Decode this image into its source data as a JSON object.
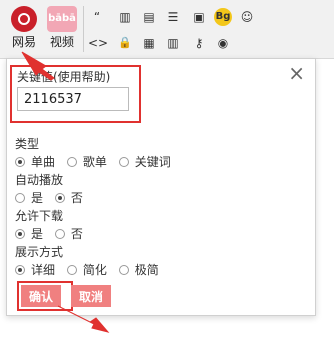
{
  "toolbar": {
    "main": [
      {
        "label": "网易",
        "icon": "netease-music-icon"
      },
      {
        "label": "视频",
        "icon": "video-icon",
        "badge": "bābā"
      }
    ],
    "tools": [
      {
        "icon": "quote-icon",
        "glyph": "“"
      },
      {
        "icon": "building-icon",
        "glyph": "▥"
      },
      {
        "icon": "document-icon",
        "glyph": "▤"
      },
      {
        "icon": "list-icon",
        "glyph": "☰"
      },
      {
        "icon": "folder-icon",
        "glyph": "▣"
      },
      {
        "icon": "bg-icon",
        "glyph": "Bg"
      },
      {
        "icon": "qq-icon",
        "glyph": "☺"
      },
      {
        "icon": "code-icon",
        "glyph": "<>"
      },
      {
        "icon": "lock-icon",
        "glyph": "🔒"
      },
      {
        "icon": "picture-icon",
        "glyph": "▦"
      },
      {
        "icon": "grid-icon",
        "glyph": "▥"
      },
      {
        "icon": "key-icon",
        "glyph": "⚷"
      },
      {
        "icon": "record-icon",
        "glyph": "◉"
      }
    ]
  },
  "dialog": {
    "close_label": "×",
    "keyword_label": "关键值(使用帮助)",
    "keyword_value": "2116537",
    "groups": [
      {
        "title": "类型",
        "options": [
          "单曲",
          "歌单",
          "关键词"
        ],
        "selected": 0
      },
      {
        "title": "自动播放",
        "options": [
          "是",
          "否"
        ],
        "selected": 1
      },
      {
        "title": "允许下载",
        "options": [
          "是",
          "否"
        ],
        "selected": 0
      },
      {
        "title": "展示方式",
        "options": [
          "详细",
          "简化",
          "极简"
        ],
        "selected": 0
      }
    ],
    "confirm_label": "确认",
    "cancel_label": "取消"
  },
  "colors": {
    "highlight": "#e0312f",
    "button": "#f08080",
    "brand": "#c9202a"
  }
}
